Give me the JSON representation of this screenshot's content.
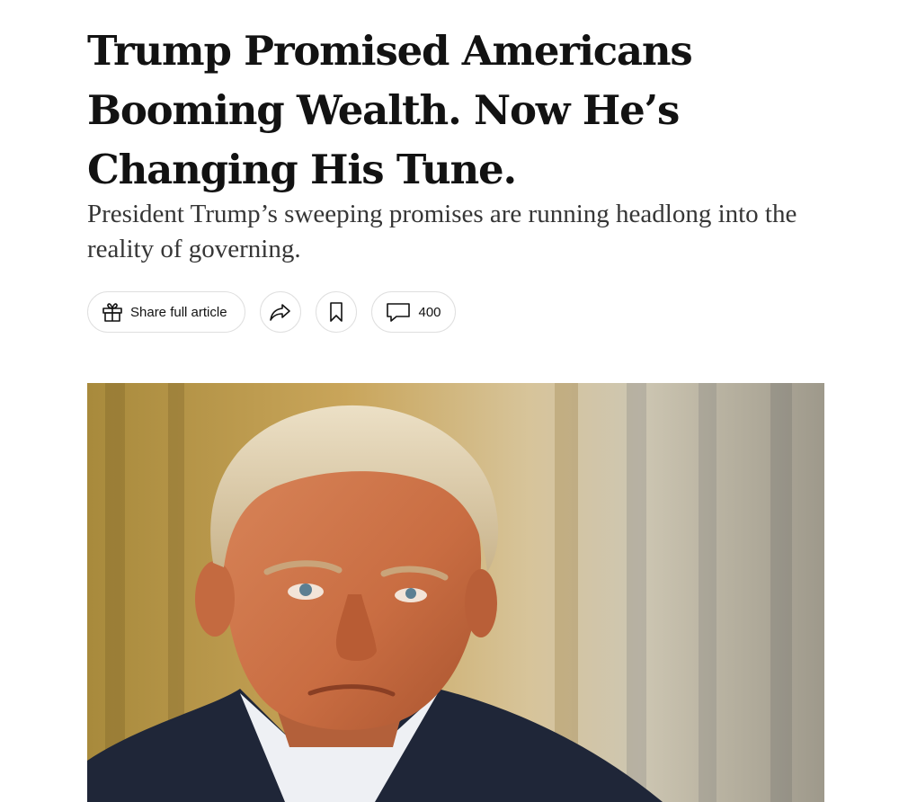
{
  "article": {
    "headline": "Trump Promised Americans Booming Wealth. Now He’s Changing His Tune.",
    "summary": "President Trump’s sweeping promises are running headlong into the reality of governing."
  },
  "share_tools": {
    "share_full_article_label": "Share full article",
    "comment_count": "400",
    "icons": {
      "gift": "gift-icon",
      "share": "share-arrow-icon",
      "save": "bookmark-icon",
      "comments": "comment-bubble-icon"
    }
  },
  "lede_image": {
    "subject": "portrait of a man in a dark suit in front of gold and cream curtains"
  }
}
